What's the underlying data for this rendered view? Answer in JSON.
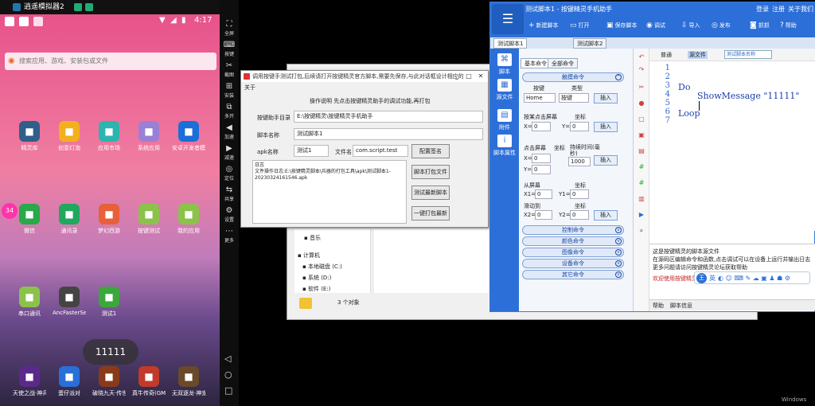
{
  "emulator": {
    "title": "逍遥模拟器2",
    "time": "4:17",
    "search_placeholder": "搜索应用、游戏、安装包或文件",
    "toast": "11111",
    "badge": "34",
    "apps_row1": [
      "精灵库",
      "创意灯泡",
      "应用市场",
      "系统应用",
      "安卓开发者模式"
    ],
    "apps_row2": [
      "微信",
      "通讯录",
      "梦幻西游",
      "按键测试",
      "我的应用"
    ],
    "apps_row3": [
      "串口通讯",
      "AncFasterSeri...",
      "测试1"
    ],
    "dock": [
      "天使之战·神兵...",
      "蛋仔派对",
      "破晓九天·传世...",
      "真牛传奇(GM...",
      "无双逐龙·神宠..."
    ],
    "sidebar": [
      "全屏",
      "按键",
      "截图",
      "安装",
      "多开",
      "加速",
      "减速",
      "定位",
      "共享",
      "设置",
      "更多"
    ]
  },
  "dialog": {
    "title": "调用按键手测试打包,后续请打开按键精灵官方脚本,需要先保存,与此对话框设计相应的",
    "menu": "关于",
    "instructions": "操作说明  先点击按键精灵助手的调试功能,再打包",
    "label_dir": "按键助手目录",
    "dir_value": "E:\\按键精灵\\按键精灵手机助手",
    "label_script": "脚本名称",
    "script_value": "测试脚本1",
    "label_apk": "apk名称",
    "apk_value": "测试1",
    "label_file": "文件名",
    "file_value": "com.script.test",
    "btn_sign": "配置签名",
    "btn_pack": "脚本打包文件",
    "btn_test": "测试最新脚本",
    "btn_onekey": "一键打包最新",
    "log_title": "日志",
    "log_text": "文件操作日志:E:\\按键精灵脚本\\兵器的打包工具\\apk\\测试脚本1-",
    "log_text2": "20230324161546.apk"
  },
  "explorer": {
    "nav": [
      "音乐",
      "计算机",
      "本地磁盘 (C:)",
      "系统 (D:)",
      "软件 (E:)"
    ],
    "status": "3 个对象"
  },
  "editor": {
    "title": "测试脚本1 - 按键精灵手机助手",
    "top_links": [
      "登录",
      "注册",
      "关于我们"
    ],
    "toolbar": [
      "新建脚本",
      "打开",
      "保存脚本",
      "调试",
      "导入",
      "发布",
      "抓抓",
      "帮助"
    ],
    "tabs": [
      "测试脚本1",
      "测试脚本2"
    ],
    "left_nav": [
      "脚本",
      "源文件",
      "附件",
      "脚本属性"
    ],
    "cmd_tabs": [
      "基本命令",
      "全部命令"
    ],
    "sections": [
      "触摸命令",
      "控制命令",
      "颜色命令",
      "图像命令",
      "设备命令",
      "其它命令"
    ],
    "key_label": "按键",
    "key_value": "Home",
    "type_label": "类型",
    "type_value": "按键",
    "insert": "插入",
    "tap_label": "按某点击屏幕",
    "coord": "坐标",
    "press_label": "点击屏幕",
    "coord2": "坐标",
    "duration_label": "持续时间(毫秒)",
    "duration_value": "1000",
    "x0": "0",
    "y0": "0",
    "swipe_from": "从屏幕",
    "swipe_to": "滑动到",
    "code_head_a": "普通",
    "code_head_b": "源文件",
    "code_head_c": "测试脚本名称",
    "line_numbers": [
      "1",
      "2",
      "3",
      "4",
      "5",
      "6",
      "7"
    ],
    "code_line3": "Do",
    "code_line4": "ShowMessage \"11111\"",
    "code_line6": "Loop",
    "info_line1": "这是按键精灵的脚本源文件",
    "info_line2": "在源码区编辑命令和函数,点击调试可以在设备上运行并输出日志",
    "info_line3": "更多问题请访问按键精灵论坛获取帮助",
    "info_line4": "欢迎使用按键精灵",
    "bottom_tabs": [
      "帮助",
      "脚本信息"
    ],
    "ime_label": "英"
  },
  "desktop": {
    "watermark": "Windows"
  }
}
